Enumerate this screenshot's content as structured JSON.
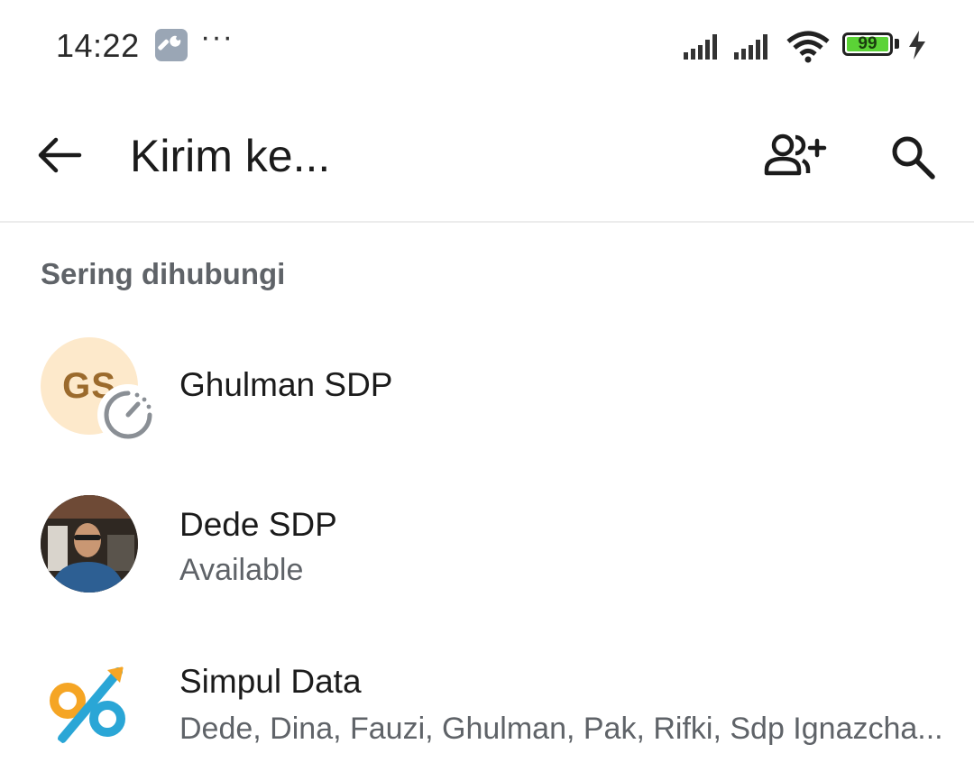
{
  "status_bar": {
    "time": "14:22",
    "icons": [
      "wrench-icon",
      "more-dots-icon",
      "signal-icon",
      "signal-icon",
      "wifi-icon",
      "battery-icon",
      "charging-icon"
    ],
    "more": "···",
    "battery_level": "99",
    "battery_color": "#5bd336"
  },
  "app_bar": {
    "title": "Kirim ke...",
    "icons": [
      "back-arrow-icon",
      "add-contact-icon",
      "search-icon"
    ]
  },
  "section": {
    "header": "Sering dihubungi"
  },
  "contacts": [
    {
      "name": "Ghulman SDP",
      "initials": "GS",
      "avatar_color": "#fde9cb",
      "badge": "timer-icon"
    },
    {
      "name": "Dede SDP",
      "subtitle": "Available",
      "avatar": "profile-photo"
    },
    {
      "name": "Simpul Data",
      "subtitle": "Dede, Dina, Fauzi, Ghulman, Pak, Rifki, Sdp Ignazcha...",
      "avatar": "percent-logo-icon"
    }
  ]
}
